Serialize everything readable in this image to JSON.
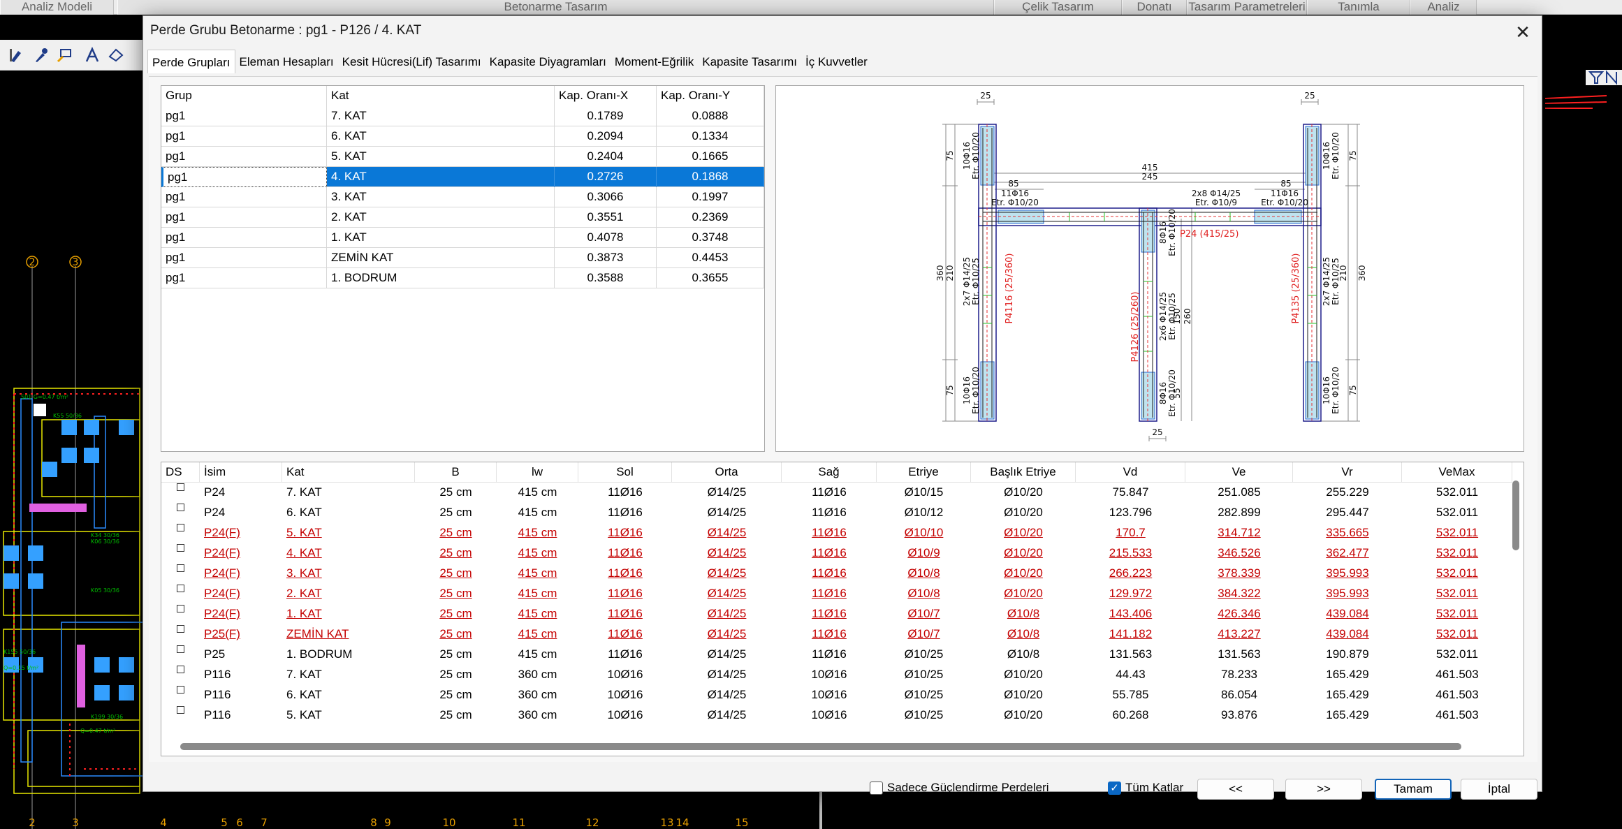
{
  "background": {
    "menu_items": [
      {
        "label": "Analiz Modeli"
      },
      {
        "label": "Betonarme Tasarım"
      },
      {
        "label": "Çelik Tasarım"
      },
      {
        "label": "Donatı"
      },
      {
        "label": "Tasarım Parametreleri"
      },
      {
        "label": "Tanımla"
      },
      {
        "label": "Analiz"
      }
    ],
    "axis_labels_top": [
      "2",
      "3"
    ],
    "axis_labels_bottom": [
      "2",
      "3",
      "4",
      "5",
      "6",
      "7",
      "8",
      "9",
      "10",
      "11",
      "12",
      "13",
      "14",
      "15"
    ]
  },
  "dialog": {
    "title": "Perde Grubu Betonarme  :  pg1 - P126 / 4. KAT",
    "close_symbol": "✕",
    "tabs": [
      {
        "label": "Perde Grupları",
        "active": true
      },
      {
        "label": "Eleman Hesapları"
      },
      {
        "label": "Kesit Hücresi(Lif) Tasarımı"
      },
      {
        "label": "Kapasite Diyagramları"
      },
      {
        "label": "Moment-Eğrilik"
      },
      {
        "label": "Kapasite Tasarımı"
      },
      {
        "label": "İç Kuvvetler"
      }
    ]
  },
  "group_grid": {
    "headers": [
      "Grup",
      "Kat",
      "Kap. Oranı-X",
      "Kap. Oranı-Y"
    ],
    "selected_index": 3,
    "rows": [
      [
        "pg1",
        "7. KAT",
        "0.1789",
        "0.0888"
      ],
      [
        "pg1",
        "6. KAT",
        "0.2094",
        "0.1334"
      ],
      [
        "pg1",
        "5. KAT",
        "0.2404",
        "0.1665"
      ],
      [
        "pg1",
        "4. KAT",
        "0.2726",
        "0.1868"
      ],
      [
        "pg1",
        "3. KAT",
        "0.3066",
        "0.1997"
      ],
      [
        "pg1",
        "2. KAT",
        "0.3551",
        "0.2369"
      ],
      [
        "pg1",
        "1. KAT",
        "0.4078",
        "0.3748"
      ],
      [
        "pg1",
        "ZEMİN KAT",
        "0.3873",
        "0.4453"
      ],
      [
        "pg1",
        "1. BODRUM",
        "0.3588",
        "0.3655"
      ]
    ]
  },
  "drawing": {
    "dims_top": [
      "25",
      "25"
    ],
    "dim_bottom": "25",
    "dim_415": "415",
    "dim_245": "245",
    "dim_85_left": "85",
    "dim_85_right": "85",
    "dim_75": "75",
    "dim_360": "360",
    "dim_210": "210",
    "dim_150": "150",
    "dim_260": "260",
    "dim_55": "55",
    "rebar_10phi16": "10Φ16",
    "stirrup_10_20": "Etr. Φ10/20",
    "rebar_2x7": "2x7 Φ14/25",
    "stirrup_10_25": "Etr. Φ10/25",
    "rebar_11phi16": "11Φ16",
    "rebar_2x8": "2x8 Φ14/25",
    "stirrup_10_9": "Etr. Φ10/9",
    "rebar_8phi16": "8Φ16",
    "rebar_2x6": "2x6 Φ14/25",
    "label_p24": "P24 (415/25)",
    "label_p4116": "P4116 (25/360)",
    "label_p4126": "P4126 (25/260)",
    "label_p4135": "P4135 (25/360)"
  },
  "detail_grid": {
    "headers": [
      "DS",
      "İsim",
      "Kat",
      "B",
      "lw",
      "Sol",
      "Orta",
      "Sağ",
      "Etriye",
      "Başlık Etriye",
      "Vd",
      "Ve",
      "Vr",
      "VeMax"
    ],
    "rows": [
      {
        "red": false,
        "cells": [
          "P24",
          "7. KAT",
          "25 cm",
          "415 cm",
          "11Ø16",
          "Ø14/25",
          "11Ø16",
          "Ø10/15",
          "Ø10/20",
          "75.847",
          "251.085",
          "255.229",
          "532.011"
        ]
      },
      {
        "red": false,
        "cells": [
          "P24",
          "6. KAT",
          "25 cm",
          "415 cm",
          "11Ø16",
          "Ø14/25",
          "11Ø16",
          "Ø10/12",
          "Ø10/20",
          "123.796",
          "282.899",
          "295.447",
          "532.011"
        ]
      },
      {
        "red": true,
        "cells": [
          "P24(F)",
          "5. KAT",
          "25 cm",
          "415 cm",
          "11Ø16",
          "Ø14/25",
          "11Ø16",
          "Ø10/10",
          "Ø10/20",
          "170.7",
          "314.712",
          "335.665",
          "532.011"
        ]
      },
      {
        "red": true,
        "cells": [
          "P24(F)",
          "4. KAT",
          "25 cm",
          "415 cm",
          "11Ø16",
          "Ø14/25",
          "11Ø16",
          "Ø10/9",
          "Ø10/20",
          "215.533",
          "346.526",
          "362.477",
          "532.011"
        ]
      },
      {
        "red": true,
        "cells": [
          "P24(F)",
          "3. KAT",
          "25 cm",
          "415 cm",
          "11Ø16",
          "Ø14/25",
          "11Ø16",
          "Ø10/8",
          "Ø10/20",
          "266.223",
          "378.339",
          "395.993",
          "532.011"
        ]
      },
      {
        "red": true,
        "cells": [
          "P24(F)",
          "2. KAT",
          "25 cm",
          "415 cm",
          "11Ø16",
          "Ø14/25",
          "11Ø16",
          "Ø10/8",
          "Ø10/20",
          "129.972",
          "384.322",
          "395.993",
          "532.011"
        ]
      },
      {
        "red": true,
        "cells": [
          "P24(F)",
          "1. KAT",
          "25 cm",
          "415 cm",
          "11Ø16",
          "Ø14/25",
          "11Ø16",
          "Ø10/7",
          "Ø10/8",
          "143.406",
          "426.346",
          "439.084",
          "532.011"
        ]
      },
      {
        "red": true,
        "cells": [
          "P25(F)",
          "ZEMİN KAT",
          "25 cm",
          "415 cm",
          "11Ø16",
          "Ø14/25",
          "11Ø16",
          "Ø10/7",
          "Ø10/8",
          "141.182",
          "413.227",
          "439.084",
          "532.011"
        ]
      },
      {
        "red": false,
        "cells": [
          "P25",
          "1. BODRUM",
          "25 cm",
          "415 cm",
          "11Ø16",
          "Ø14/25",
          "11Ø16",
          "Ø10/25",
          "Ø10/8",
          "131.563",
          "131.563",
          "190.879",
          "532.011"
        ]
      },
      {
        "red": false,
        "cells": [
          "P116",
          "7. KAT",
          "25 cm",
          "360 cm",
          "10Ø16",
          "Ø14/25",
          "10Ø16",
          "Ø10/25",
          "Ø10/20",
          "44.43",
          "78.233",
          "165.429",
          "461.503"
        ]
      },
      {
        "red": false,
        "cells": [
          "P116",
          "6. KAT",
          "25 cm",
          "360 cm",
          "10Ø16",
          "Ø14/25",
          "10Ø16",
          "Ø10/25",
          "Ø10/20",
          "55.785",
          "86.054",
          "165.429",
          "461.503"
        ]
      },
      {
        "red": false,
        "cells": [
          "P116",
          "5. KAT",
          "25 cm",
          "360 cm",
          "10Ø16",
          "Ø14/25",
          "10Ø16",
          "Ø10/25",
          "Ø10/20",
          "60.268",
          "93.876",
          "165.429",
          "461.503"
        ]
      }
    ]
  },
  "footer": {
    "only_strengthening_label": "Sadece Güçlendirme Perdeleri",
    "only_strengthening_checked": false,
    "all_floors_label": "Tüm Katlar",
    "all_floors_checked": true,
    "prev_label": "<<",
    "next_label": ">>",
    "ok_label": "Tamam",
    "cancel_label": "İptal"
  },
  "colors": {
    "selection": "#0a78d7",
    "warning_red": "#c40000",
    "cad_background": "#000000",
    "cad_yellow": "#e8e800",
    "cad_red": "#ff2020"
  }
}
